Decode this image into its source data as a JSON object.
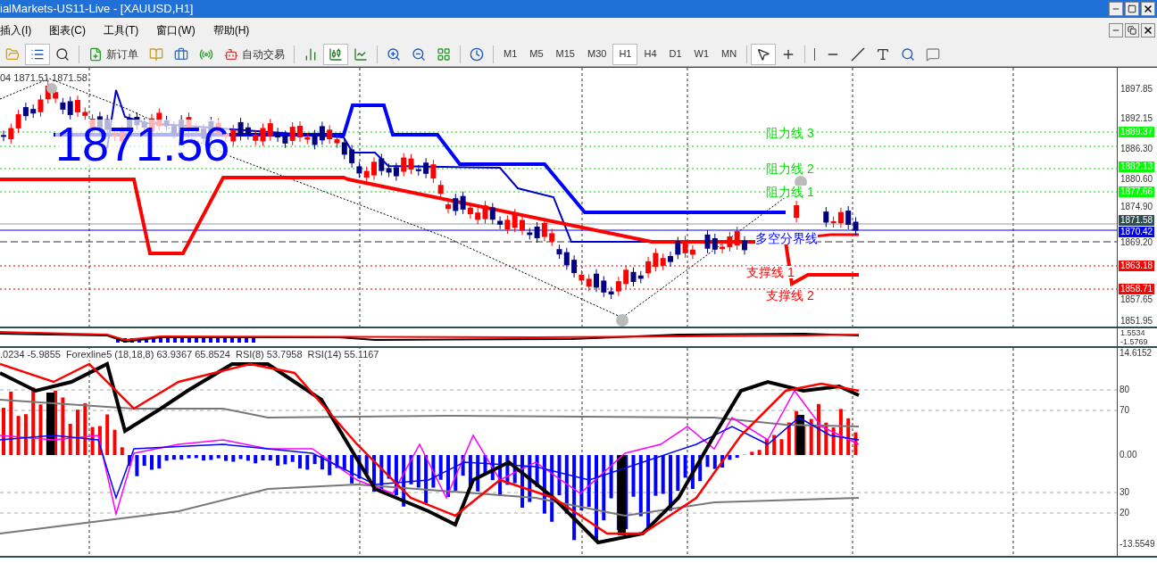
{
  "window": {
    "title": "ialMarkets-US11-Live - [XAUUSD,H1]"
  },
  "menu": [
    "插入(I)",
    "图表(C)",
    "工具(T)",
    "窗口(W)",
    "帮助(H)"
  ],
  "toolbar": {
    "new_order": "新订单",
    "auto_trading": "自动交易",
    "timeframes": [
      {
        "label": "M1",
        "selected": false
      },
      {
        "label": "M5",
        "selected": false
      },
      {
        "label": "M15",
        "selected": false
      },
      {
        "label": "M30",
        "selected": false
      },
      {
        "label": "H1",
        "selected": true
      },
      {
        "label": "H4",
        "selected": false
      },
      {
        "label": "D1",
        "selected": false
      },
      {
        "label": "W1",
        "selected": false
      },
      {
        "label": "MN",
        "selected": false
      }
    ],
    "tools": [
      {
        "kind": "cursor",
        "selected": true
      },
      {
        "kind": "crosshair",
        "selected": false
      }
    ]
  },
  "chart": {
    "header": "04 1871.51 1871.58",
    "price_big": "1871.56",
    "levels": [
      {
        "label": "阻力线 3",
        "color": "#00dd00"
      },
      {
        "label": "阻力线 2",
        "color": "#00dd00"
      },
      {
        "label": "阻力线 1",
        "color": "#00dd00"
      },
      {
        "label": "多空分界线",
        "color": "#0000ff"
      },
      {
        "label": "支撑线 1",
        "color": "#ff0000"
      },
      {
        "label": "支撑线 2",
        "color": "#ff0000"
      }
    ],
    "price_ticks": [
      "1897.85",
      "1892.15",
      "1886.30",
      "1880.60",
      "1874.90",
      "1869.20",
      "1857.65",
      "1851.95"
    ],
    "price_tags": [
      {
        "label": "1889.37",
        "color": "#00ff00"
      },
      {
        "label": "1882.13",
        "color": "#00ff00"
      },
      {
        "label": "1877.66",
        "color": "#00ff00"
      },
      {
        "label": "1871.58",
        "color": "#2f4f4f"
      },
      {
        "label": "1870.42",
        "color": "#0000ff"
      },
      {
        "label": "1863.18",
        "color": "#ff0000"
      },
      {
        "label": "1858.71",
        "color": "#ff0000"
      }
    ]
  },
  "oscillator": {
    "ticks": [
      "1.5534",
      "-1.5769"
    ]
  },
  "indicator": {
    "legend": [
      ".0234 -5.9855",
      "Forexline5 (18,18,8) 63.9367 65.8524",
      "RSI(8) 53.7958",
      "RSI(14) 55.1167"
    ],
    "ticks": [
      "14.6152",
      "80",
      "70",
      "0.00",
      "30",
      "20",
      "-13.5549"
    ]
  }
}
